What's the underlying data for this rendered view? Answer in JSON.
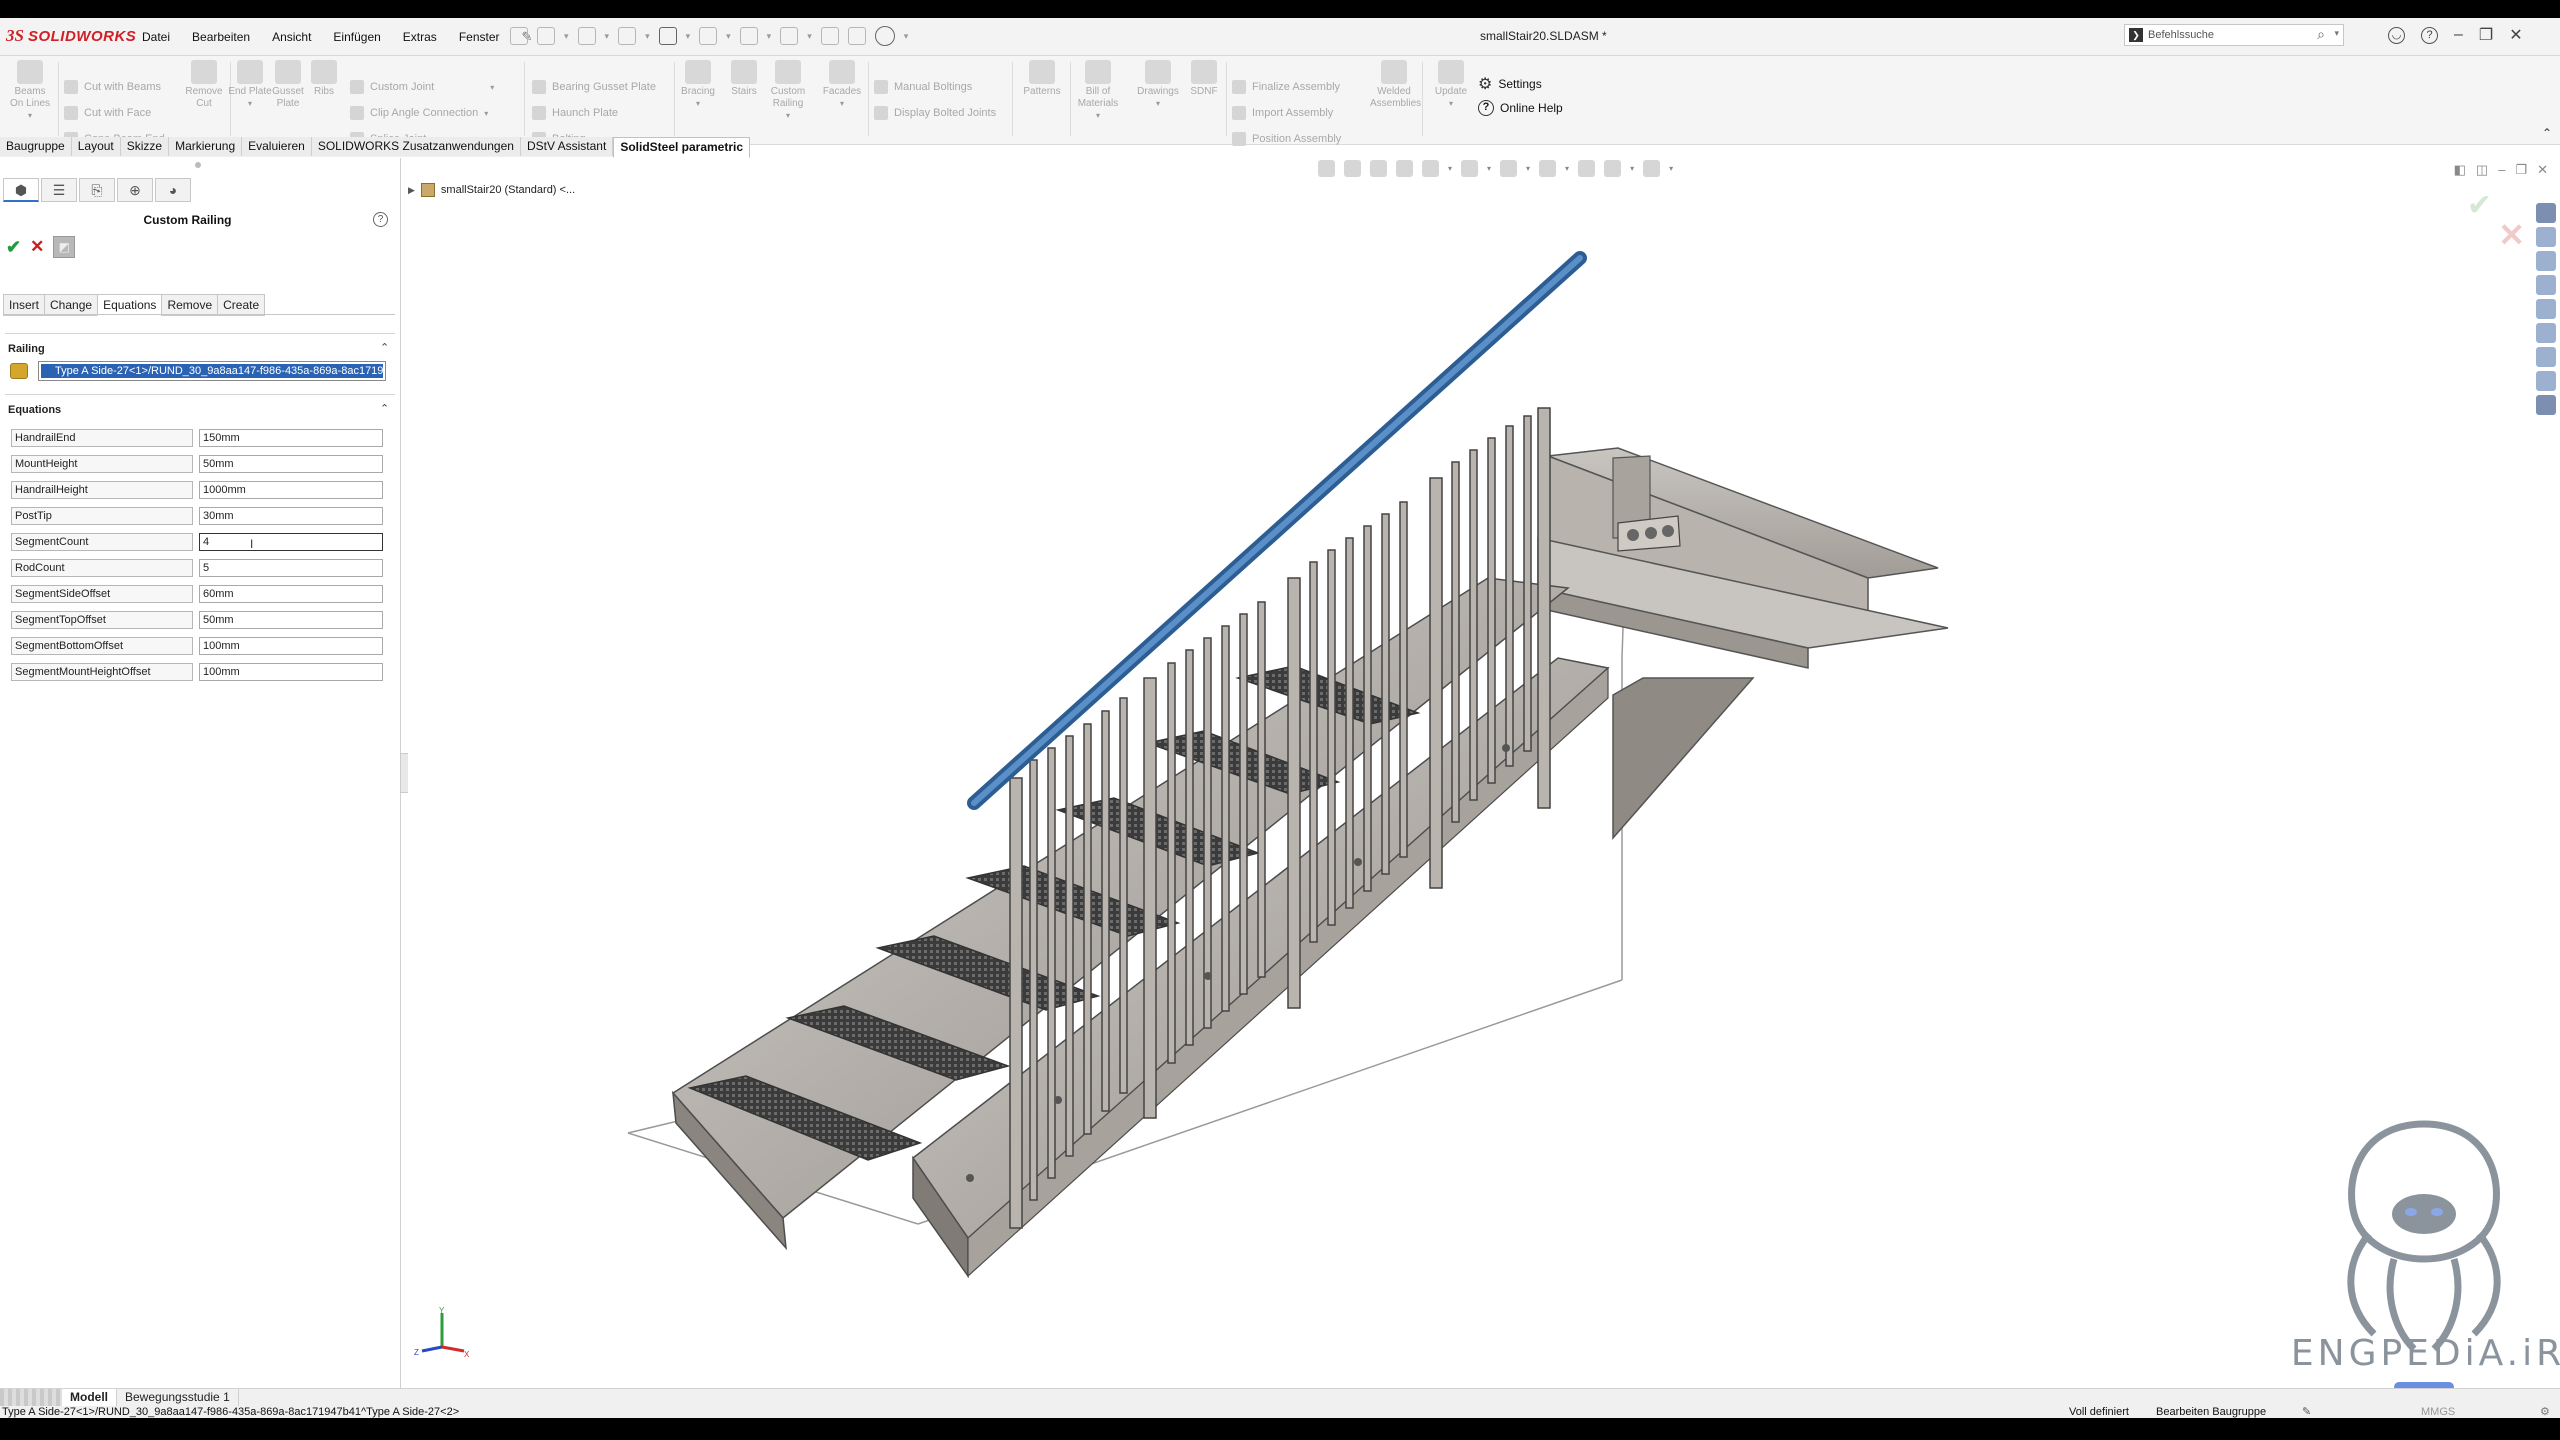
{
  "app": {
    "logo_ds": "3S",
    "logo_name": "SOLIDWORKS",
    "document_title": "smallStair20.SLDASM *",
    "search_placeholder": "Befehlssuche"
  },
  "menu": [
    "Datei",
    "Bearbeiten",
    "Ansicht",
    "Einfügen",
    "Extras",
    "Fenster"
  ],
  "ribbon": {
    "beams_on_lines": "Beams On Lines",
    "cut_with_beams": "Cut with Beams",
    "cut_with_face": "Cut with Face",
    "cope_beam_end": "Cope Beam End",
    "remove_cut": "Remove Cut",
    "end_plate": "End Plate",
    "gusset_plate": "Gusset Plate",
    "ribs": "Ribs",
    "custom_joint": "Custom Joint",
    "clip_angle_connection": "Clip Angle Connection",
    "splice_joint": "Splice Joint",
    "bearing_gusset_plate": "Bearing Gusset Plate",
    "haunch_plate": "Haunch Plate",
    "bolting": "Bolting",
    "bracing": "Bracing",
    "stairs": "Stairs",
    "custom_railing": "Custom Railing",
    "facades": "Facades",
    "manual_boltings": "Manual Boltings",
    "display_bolted_joints": "Display Bolted Joints",
    "patterns": "Patterns",
    "bill_of_materials": "Bill of Materials",
    "drawings": "Drawings",
    "sdnf": "SDNF",
    "finalize_assembly": "Finalize Assembly",
    "import_assembly": "Import Assembly",
    "position_assembly": "Position Assembly",
    "welded_assemblies": "Welded Assemblies",
    "update": "Update",
    "settings": "Settings",
    "online_help": "Online Help"
  },
  "tabs": [
    "Baugruppe",
    "Layout",
    "Skizze",
    "Markierung",
    "Evaluieren",
    "SOLIDWORKS Zusatzanwendungen",
    "DStV Assistant",
    "SolidSteel parametric"
  ],
  "panel": {
    "title": "Custom Railing",
    "subtabs": [
      "Insert",
      "Change",
      "Equations",
      "Remove",
      "Create"
    ],
    "railing_section": "Railing",
    "railing_selection": "Type A Side-27<1>/RUND_30_9a8aa147-f986-435a-869a-8ac1719",
    "equations_section": "Equations",
    "equations": [
      {
        "name": "HandrailEnd",
        "value": "150mm"
      },
      {
        "name": "MountHeight",
        "value": "50mm"
      },
      {
        "name": "HandrailHeight",
        "value": "1000mm"
      },
      {
        "name": "PostTip",
        "value": "30mm"
      },
      {
        "name": "SegmentCount",
        "value": "4"
      },
      {
        "name": "RodCount",
        "value": "5"
      },
      {
        "name": "SegmentSideOffset",
        "value": "60mm"
      },
      {
        "name": "SegmentTopOffset",
        "value": "50mm"
      },
      {
        "name": "SegmentBottomOffset",
        "value": "100mm"
      },
      {
        "name": "SegmentMountHeightOffset",
        "value": "100mm"
      }
    ]
  },
  "graphics": {
    "tree_item": "smallStair20 (Standard) <...",
    "watermark": "ENGPEDiA.iR"
  },
  "bottom_tabs": [
    "Modell",
    "Bewegungsstudie 1"
  ],
  "status": {
    "path": "Type A Side-27<1>/RUND_30_9a8aa147-f986-435a-869a-8ac171947b41^Type A Side-27<2>",
    "defined": "Voll definiert",
    "editing": "Bearbeiten Baugruppe",
    "units": "MMGS"
  }
}
